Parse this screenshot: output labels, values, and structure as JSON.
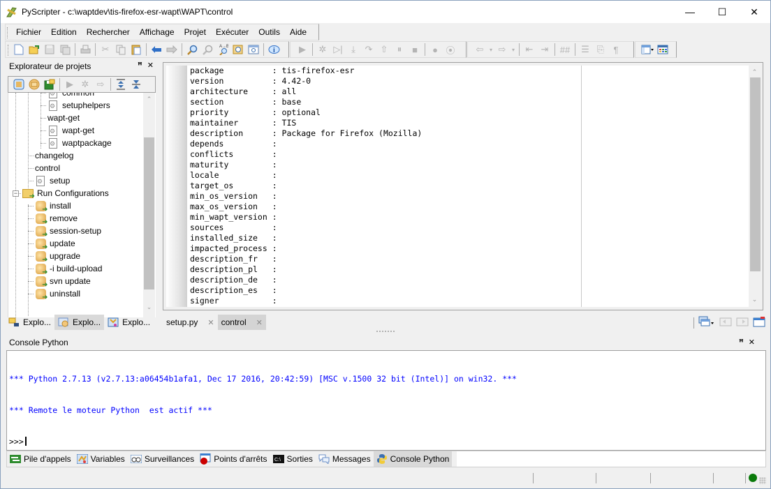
{
  "window": {
    "title": "PyScripter - c:\\waptdev\\tis-firefox-esr-wapt\\WAPT\\control",
    "controls": {
      "minimize": "—",
      "maximize": "☐",
      "close": "✕"
    }
  },
  "menu": [
    "Fichier",
    "Edition",
    "Rechercher",
    "Affichage",
    "Projet",
    "Exécuter",
    "Outils",
    "Aide"
  ],
  "toolbar_main": {
    "icons": [
      "new-file",
      "open-file",
      "save",
      "save-all",
      "print",
      "cut",
      "copy",
      "paste",
      "undo",
      "redo",
      "find",
      "find-next",
      "replace",
      "find-in-files",
      "goto",
      "python-help"
    ]
  },
  "toolbar_run": {
    "icons": [
      "run",
      "debug",
      "run-to-cursor",
      "step-into",
      "step-over",
      "step-out",
      "pause",
      "abort",
      "toggle-breakpoint",
      "clear-breakpoints"
    ]
  },
  "toolbar_nav": {
    "icons": [
      "back",
      "forward",
      "indent",
      "dedent",
      "comment",
      "line-numbers",
      "show-tabs",
      "show-whitespace"
    ]
  },
  "toolbar_view": {
    "icons": [
      "layout",
      "editor-view"
    ]
  },
  "project_explorer": {
    "title": "Explorateur de projets",
    "tree": [
      {
        "label": "common",
        "level": 3,
        "icon": "file",
        "partial": true
      },
      {
        "label": "setuphelpers",
        "level": 3,
        "icon": "file"
      },
      {
        "label": "wapt-get",
        "level": 3,
        "icon": "none"
      },
      {
        "label": "wapt-get",
        "level": 3,
        "icon": "file"
      },
      {
        "label": "waptpackage",
        "level": 3,
        "icon": "file"
      },
      {
        "label": "changelog",
        "level": 2,
        "icon": "none"
      },
      {
        "label": "control",
        "level": 2,
        "icon": "none"
      },
      {
        "label": "setup",
        "level": 2,
        "icon": "file"
      },
      {
        "label": "Run Configurations",
        "level": 1,
        "icon": "folder-run",
        "expanded": true
      },
      {
        "label": "install",
        "level": 2,
        "icon": "run"
      },
      {
        "label": "remove",
        "level": 2,
        "icon": "run"
      },
      {
        "label": "session-setup",
        "level": 2,
        "icon": "run"
      },
      {
        "label": "update",
        "level": 2,
        "icon": "run"
      },
      {
        "label": "upgrade",
        "level": 2,
        "icon": "run"
      },
      {
        "label": "-i build-upload",
        "level": 2,
        "icon": "run"
      },
      {
        "label": "svn update",
        "level": 2,
        "icon": "run"
      },
      {
        "label": "uninstall",
        "level": 2,
        "icon": "run"
      }
    ],
    "tabs": [
      {
        "label": "Explo...",
        "active": false
      },
      {
        "label": "Explo...",
        "active": true
      },
      {
        "label": "Explo...",
        "active": false
      }
    ]
  },
  "editor": {
    "lines": [
      {
        "key": "package",
        "value": "tis-firefox-esr"
      },
      {
        "key": "version",
        "value": "4.42-0"
      },
      {
        "key": "architecture",
        "value": "all"
      },
      {
        "key": "section",
        "value": "base"
      },
      {
        "key": "priority",
        "value": "optional"
      },
      {
        "key": "maintainer",
        "value": "TIS"
      },
      {
        "key": "description",
        "value": "Package for Firefox (Mozilla)"
      },
      {
        "key": "depends",
        "value": ""
      },
      {
        "key": "conflicts",
        "value": ""
      },
      {
        "key": "maturity",
        "value": ""
      },
      {
        "key": "locale",
        "value": ""
      },
      {
        "key": "target_os",
        "value": ""
      },
      {
        "key": "min_os_version",
        "value": ""
      },
      {
        "key": "max_os_version",
        "value": ""
      },
      {
        "key": "min_wapt_version",
        "value": ""
      },
      {
        "key": "sources",
        "value": ""
      },
      {
        "key": "installed_size",
        "value": ""
      },
      {
        "key": "impacted_process",
        "value": ""
      },
      {
        "key": "description_fr",
        "value": ""
      },
      {
        "key": "description_pl",
        "value": ""
      },
      {
        "key": "description_de",
        "value": ""
      },
      {
        "key": "description_es",
        "value": ""
      },
      {
        "key": "signer",
        "value": ""
      }
    ],
    "tabs": [
      {
        "label": "setup.py",
        "active": false
      },
      {
        "label": "control",
        "active": true
      }
    ]
  },
  "console": {
    "title": "Console Python",
    "lines": [
      "*** Python 2.7.13 (v2.7.13:a06454b1afa1, Dec 17 2016, 20:42:59) [MSC v.1500 32 bit (Intel)] on win32. ***",
      "*** Remote le moteur Python  est actif ***"
    ],
    "prompt": ">>>"
  },
  "bottom_tabs": [
    {
      "label": "Pile d'appels",
      "icon": "call-stack"
    },
    {
      "label": "Variables",
      "icon": "variables"
    },
    {
      "label": "Surveillances",
      "icon": "watches"
    },
    {
      "label": "Points d'arrêts",
      "icon": "breakpoints"
    },
    {
      "label": "Sorties",
      "icon": "output"
    },
    {
      "label": "Messages",
      "icon": "messages"
    },
    {
      "label": "Console Python",
      "icon": "python",
      "active": true
    }
  ],
  "status": {
    "engine_state": "running",
    "led_color": "#0a7a0a"
  },
  "colors": {
    "console_text": "#0000ff",
    "title_bg": "#ffffff",
    "chrome_bg": "#f0f0f0"
  }
}
